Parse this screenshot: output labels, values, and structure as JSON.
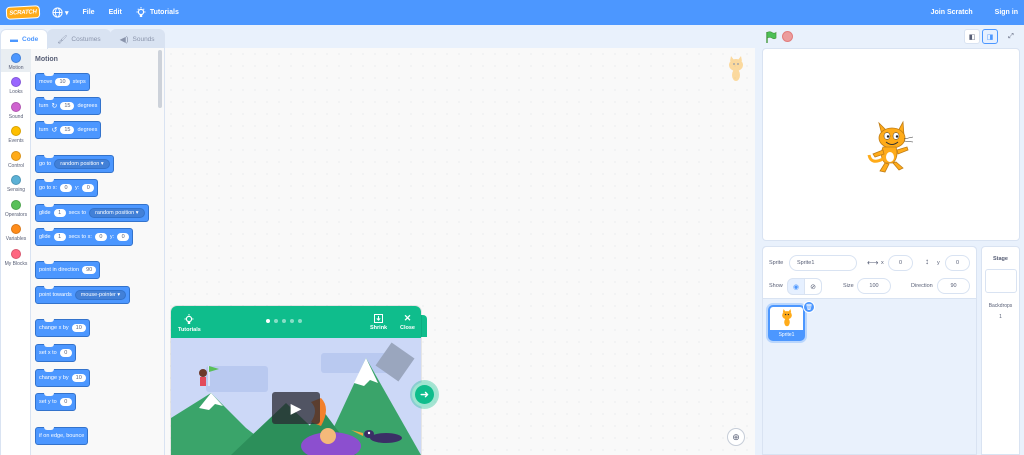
{
  "menubar": {
    "logo": "SCRATCH",
    "file": "File",
    "edit": "Edit",
    "tutorials": "Tutorials",
    "join": "Join Scratch",
    "signin": "Sign in"
  },
  "tabs": {
    "code": "Code",
    "costumes": "Costumes",
    "sounds": "Sounds"
  },
  "categories": [
    {
      "label": "Motion",
      "color": "#4c97ff"
    },
    {
      "label": "Looks",
      "color": "#9966ff"
    },
    {
      "label": "Sound",
      "color": "#cf63cf"
    },
    {
      "label": "Events",
      "color": "#ffbf00"
    },
    {
      "label": "Control",
      "color": "#ffab19"
    },
    {
      "label": "Sensing",
      "color": "#5cb1d6"
    },
    {
      "label": "Operators",
      "color": "#59c059"
    },
    {
      "label": "Variables",
      "color": "#ff8c1a"
    },
    {
      "label": "My Blocks",
      "color": "#ff6680"
    }
  ],
  "palette": {
    "title": "Motion",
    "move": {
      "a": "move",
      "v": "10",
      "b": "steps"
    },
    "turn_right": {
      "a": "turn",
      "v": "15",
      "b": "degrees"
    },
    "turn_left": {
      "a": "turn",
      "v": "15",
      "b": "degrees"
    },
    "goto": {
      "a": "go to",
      "d": "random position ▾"
    },
    "goto_xy": {
      "a": "go to x:",
      "x": "0",
      "b": "y:",
      "y": "0"
    },
    "glide_to": {
      "a": "glide",
      "v": "1",
      "b": "secs to",
      "d": "random position ▾"
    },
    "glide_xy": {
      "a": "glide",
      "v": "1",
      "b": "secs to x:",
      "x": "0",
      "c": "y:",
      "y": "0"
    },
    "point_dir": {
      "a": "point in direction",
      "v": "90"
    },
    "point_towards": {
      "a": "point towards",
      "d": "mouse-pointer ▾"
    },
    "change_x": {
      "a": "change x by",
      "v": "10"
    },
    "set_x": {
      "a": "set x to",
      "v": "0"
    },
    "change_y": {
      "a": "change y by",
      "v": "10"
    },
    "set_y": {
      "a": "set y to",
      "v": "0"
    },
    "bounce": {
      "a": "if on edge, bounce"
    }
  },
  "tutorial_card": {
    "tutorials": "Tutorials",
    "shrink": "Shrink",
    "close": "Close",
    "steps": 5,
    "current_step": 1
  },
  "sprite": {
    "label_sprite": "Sprite",
    "name": "Sprite1",
    "label_x": "x",
    "x": "0",
    "label_y": "y",
    "y": "0",
    "label_show": "Show",
    "label_size": "Size",
    "size": "100",
    "label_direction": "Direction",
    "direction": "90",
    "tile_name": "Sprite1"
  },
  "stage_panel": {
    "title": "Stage",
    "backdrops_label": "Backdrops",
    "backdrops_count": "1"
  }
}
